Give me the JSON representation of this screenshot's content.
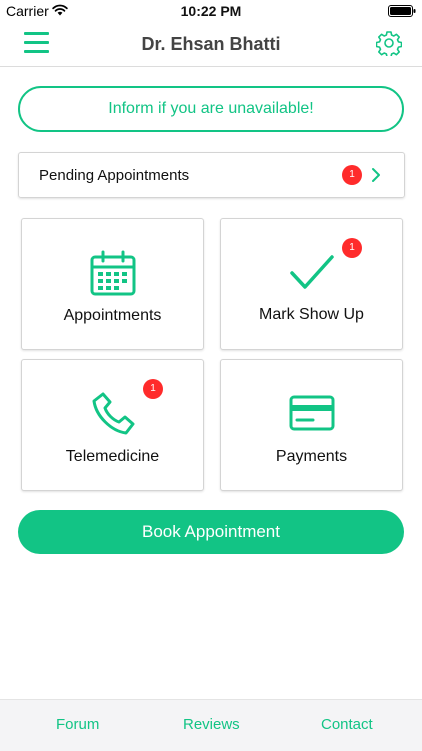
{
  "status_bar": {
    "carrier": "Carrier",
    "time": "10:22 PM",
    "wifi_icon": "wifi-icon",
    "battery_icon": "battery-icon"
  },
  "nav": {
    "title": "Dr. Ehsan Bhatti",
    "menu_icon": "hamburger-menu-icon",
    "settings_icon": "gear-icon"
  },
  "inform_button": {
    "label": "Inform if you are unavailable!"
  },
  "pending": {
    "label": "Pending Appointments",
    "badge": "1"
  },
  "tiles": [
    {
      "label": "Appointments",
      "icon": "calendar-icon",
      "badge": ""
    },
    {
      "label": "Mark Show Up",
      "icon": "checkmark-icon",
      "badge": "1"
    },
    {
      "label": "Telemedicine",
      "icon": "phone-icon",
      "badge": "1"
    },
    {
      "label": "Payments",
      "icon": "credit-card-icon",
      "badge": ""
    }
  ],
  "book_button": {
    "label": "Book Appointment"
  },
  "tab_bar": [
    {
      "label": "Forum"
    },
    {
      "label": "Reviews"
    },
    {
      "label": "Contact"
    }
  ],
  "colors": {
    "accent": "#12c485",
    "badge": "#ff2b2b",
    "title_text": "#444444",
    "tab_bar_bg": "#f4f4f6"
  }
}
